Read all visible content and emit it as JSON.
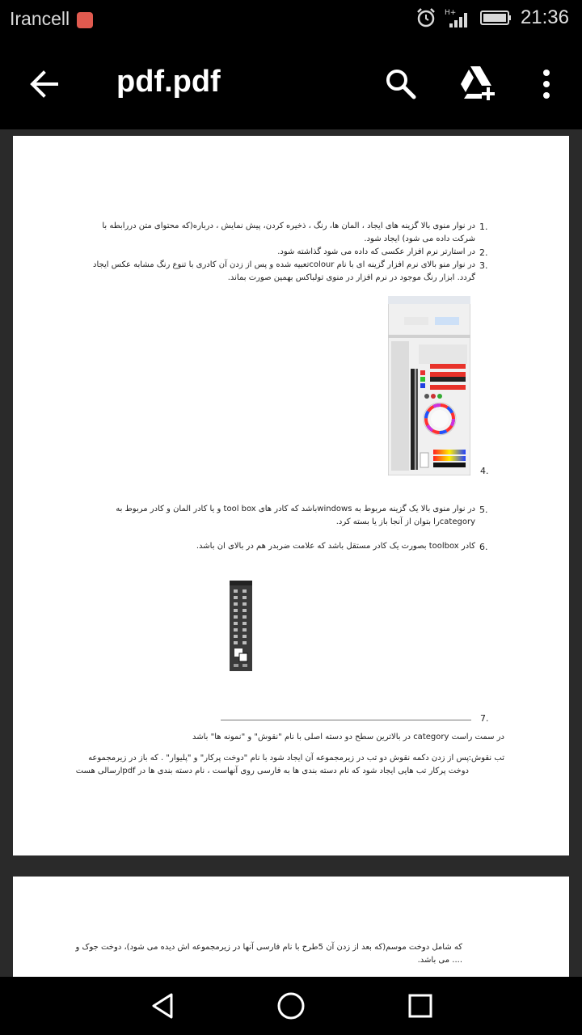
{
  "status": {
    "carrier": "Irancell",
    "time": "21:36"
  },
  "toolbar": {
    "title": "pdf.pdf",
    "icons": [
      "back-arrow-icon",
      "search-icon",
      "drive-add-icon",
      "more-vert-icon"
    ]
  },
  "document": {
    "page1": {
      "item1_num": "1.",
      "item1_line1": "در نوار منوی بالا  گزینه های ایجاد ، المان ها، رنگ ، ذخیره کردن، پیش نمایش ، درباره(که محتوای متن دررابطه با",
      "item1_line2": "شرکت داده می شود) ایجاد شود.",
      "item2_num": "2.",
      "item2_line1": "در استارتر نرم افزار عکسی که داده می شود گذاشته شود.",
      "item3_num": "3.",
      "item3_line1": "در نوار منو بالای نرم افزار گزینه ای با نام  colourتعبیه شده و پس از زدن آن کادری با تنوع رنگ مشابه عکس ایجاد",
      "item3_line2": "گردد.  ابزار رنگ موجود در نرم افزار در منوی تولباکس بهمین صورت بماند.",
      "item4_num": "4.",
      "item5_num": "5.",
      "item5_line1": "در نوار منوی بالا یک گزینه مربوط به  windowsباشد که کادر های  tool box و یا کادر المان و کادر مربوط به",
      "item5_line2": "categoryرا بتوان از آنجا باز یا بسته کرد.",
      "item6_num": "6.",
      "item6_line1": "کادر  toolbox بصورت یک کادر مستقل باشد که علامت ضربدر هم در بالای ان باشد.",
      "item7_num": "7.",
      "item7_line1": "در سمت راست  category  در بالاترین سطح دو دسته اصلی با نام \"نقوش\" و \"نمونه ها\" باشد",
      "tab_label": "تب نقوش:",
      "tab_line1": "پس از زدن دکمه نقوش دو تب در زیرمجموعه آن ایجاد شود با نام  \"دوخت پرکار\" و \"پلیوار\" . که باز در زیرمجموعه",
      "tab_line2": "دوخت پرکار تب هایی ایجاد شود که نام دسته بندی ها به فارسی روی آنهاست ، نام دسته بندی ها در  pdfارسالی هست"
    },
    "page2": {
      "line1": "که شامل دوخت موسم(که بعد از زدن آن 5طرح  با نام فارسی آنها در زیرمجموعه اش دیده می شود)، دوخت جوک و",
      "line2": ".... می باشد."
    }
  },
  "navigation": {
    "icons": [
      "back-triangle-icon",
      "home-circle-icon",
      "recents-square-icon"
    ]
  },
  "colors": {
    "background": "#000000",
    "page": "#ffffff",
    "viewer": "#2a2a2a",
    "badge": "#e05a4f"
  }
}
